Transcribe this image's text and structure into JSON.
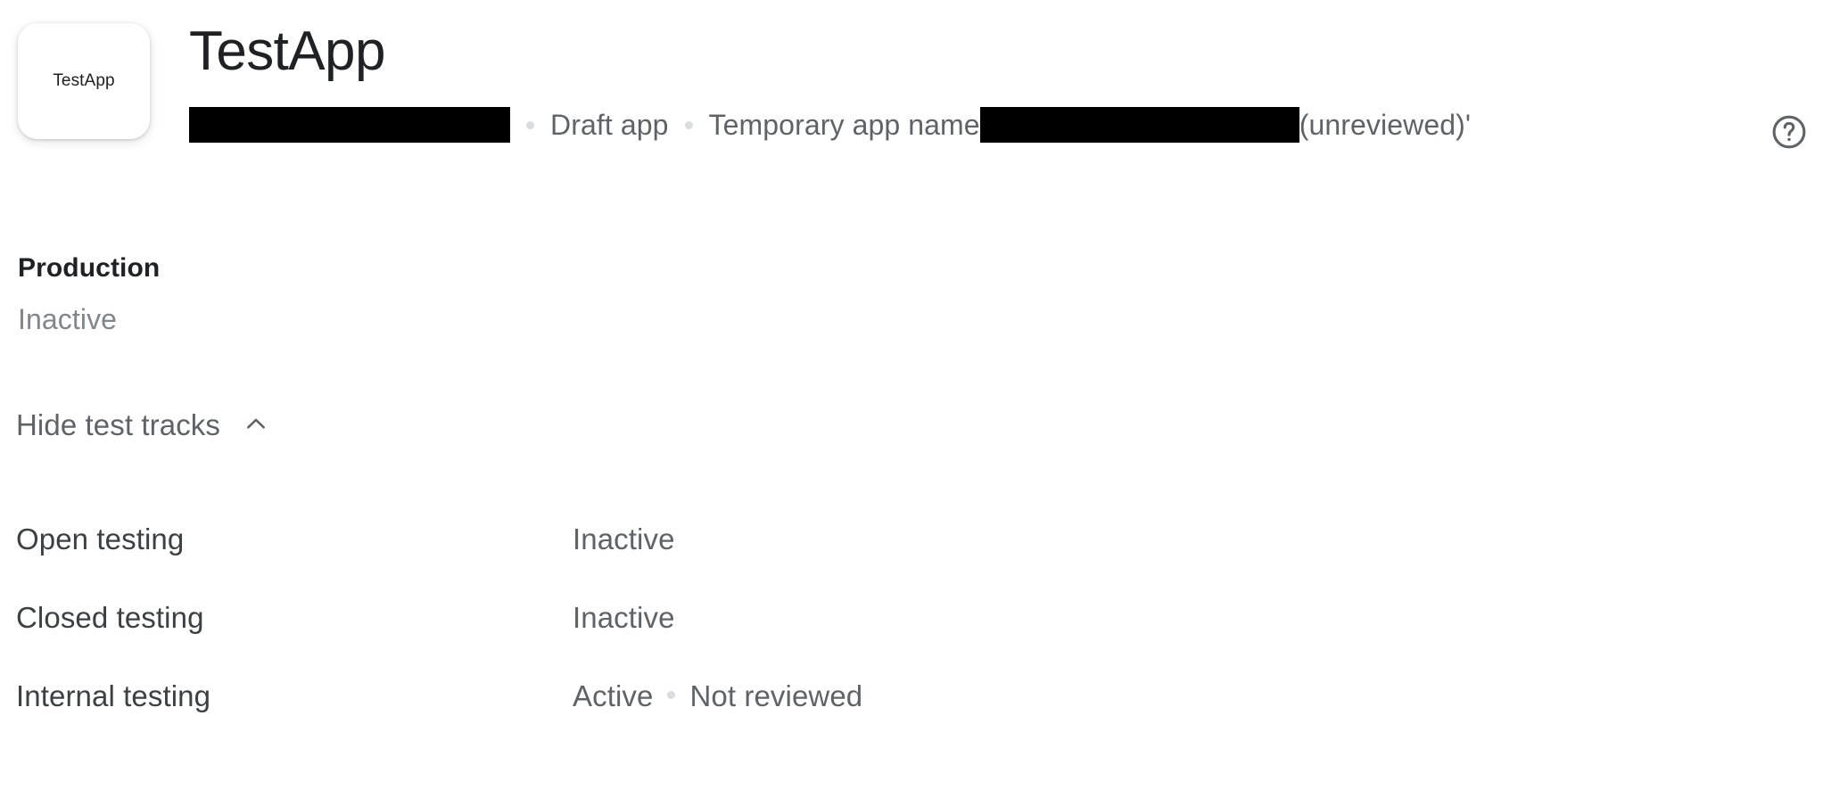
{
  "header": {
    "app_icon_label": "TestApp",
    "title": "TestApp",
    "subtitle": {
      "redacted_1": "",
      "segment_1": "Draft app",
      "segment_2": "Temporary app name",
      "redacted_2": "",
      "segment_3": "(unreviewed)'"
    },
    "help_icon": "help-circle-icon"
  },
  "production": {
    "heading": "Production",
    "status": "Inactive"
  },
  "tracks_toggle": {
    "label": "Hide test tracks",
    "icon": "chevron-up-icon"
  },
  "tracks": [
    {
      "name": "Open testing",
      "status": "Inactive",
      "status_secondary": ""
    },
    {
      "name": "Closed testing",
      "status": "Inactive",
      "status_secondary": ""
    },
    {
      "name": "Internal testing",
      "status": "Active",
      "status_secondary": "Not reviewed"
    }
  ],
  "colors": {
    "title": "#202124",
    "body_text": "#3c4043",
    "muted_text": "#5f6368",
    "light_text": "#80868b",
    "separator_dot": "#dadce0",
    "redaction": "#000000",
    "background": "#ffffff"
  }
}
